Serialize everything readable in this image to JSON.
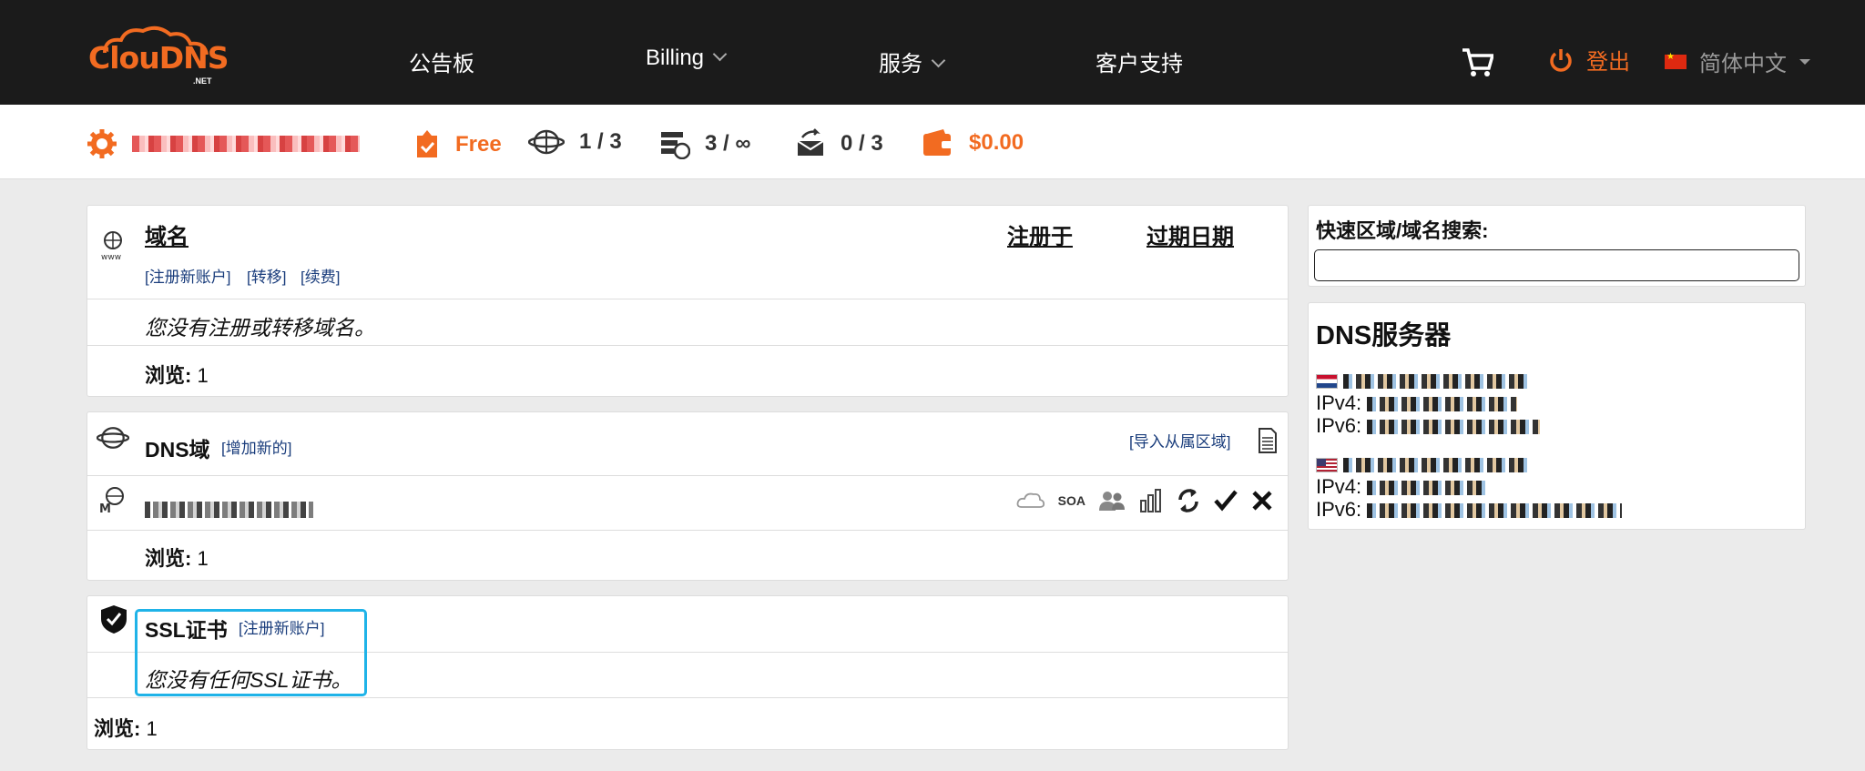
{
  "logo": {
    "brand": "ClouDNS",
    "sub": ".NET"
  },
  "nav": {
    "items": [
      {
        "label": "公告板"
      },
      {
        "label": "Billing"
      },
      {
        "label": "服务"
      },
      {
        "label": "客户支持"
      }
    ],
    "logout": "登出",
    "language": "简体中文"
  },
  "stats": {
    "plan": "Free",
    "zones": "1 / 3",
    "records": "3 / ∞",
    "mail": "0 / 3",
    "balance": "$0.00"
  },
  "domains": {
    "header": "域名",
    "col_registered": "注册于",
    "col_expiry": "过期日期",
    "links": [
      "[注册新账户]",
      "[转移]",
      "[续费]"
    ],
    "empty": "您没有注册或转移域名。",
    "browse_label": "浏览:",
    "browse_value": "1"
  },
  "dns_zones": {
    "title": "DNS域",
    "add_link": "[增加新的]",
    "import_link": "[导入从属区域]",
    "soa": "SOA",
    "browse_label": "浏览:",
    "browse_value": "1"
  },
  "ssl": {
    "title": "SSL证书",
    "register_link": "[注册新账户]",
    "empty": "您没有任何SSL证书。",
    "browse_label": "浏览:",
    "browse_value": "1"
  },
  "quick_search": {
    "label": "快速区域/域名搜索:",
    "value": ""
  },
  "dns_servers": {
    "title": "DNS服务器",
    "servers": [
      {
        "ipv4_label": "IPv4:",
        "ipv6_label": "IPv6:"
      },
      {
        "ipv4_label": "IPv4:",
        "ipv6_label": "IPv6:"
      }
    ]
  },
  "colors": {
    "accent": "#f26b21",
    "nav_bg": "#1b1b1b",
    "highlight": "#1fb3e8",
    "link": "#1a3d7c"
  }
}
